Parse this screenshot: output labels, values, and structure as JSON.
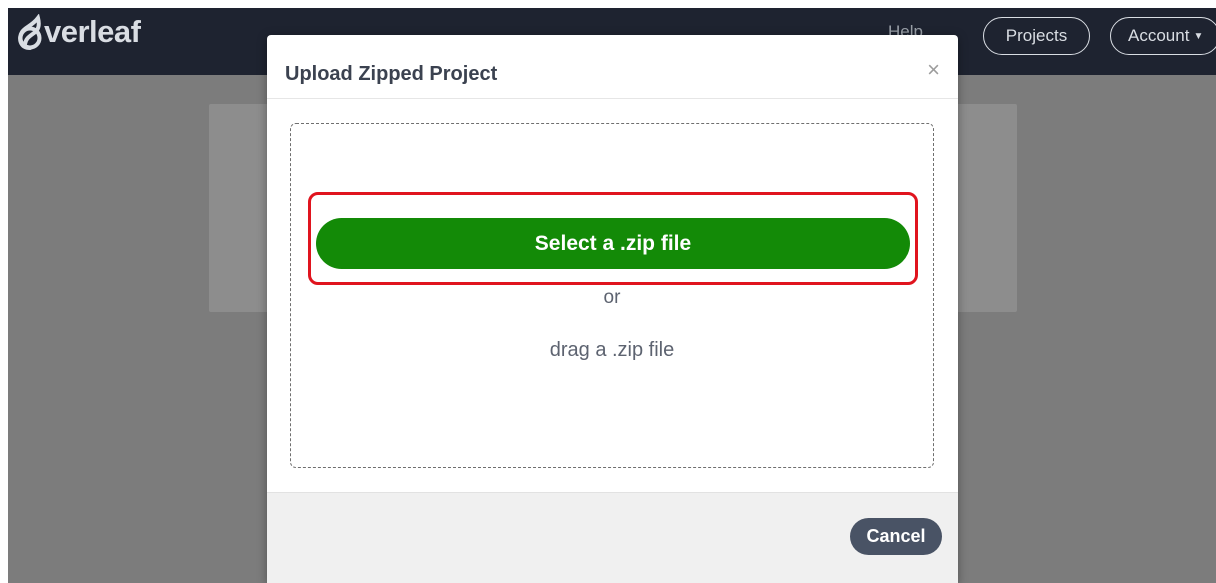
{
  "navbar": {
    "logo_text": "verleaf",
    "help_label": "Help",
    "projects_label": "Projects",
    "account_label": "Account",
    "account_caret_icon": "caret-down-icon"
  },
  "modal": {
    "title": "Upload Zipped Project",
    "close_label": "×",
    "select_button_label": "Select a .zip file",
    "or_text": "or",
    "drag_text": "drag a .zip file",
    "cancel_label": "Cancel"
  },
  "colors": {
    "navbar_bg": "#1e2330",
    "accent_green": "#138a07",
    "highlight_red": "#e0141e",
    "cancel_bg": "#495365"
  }
}
